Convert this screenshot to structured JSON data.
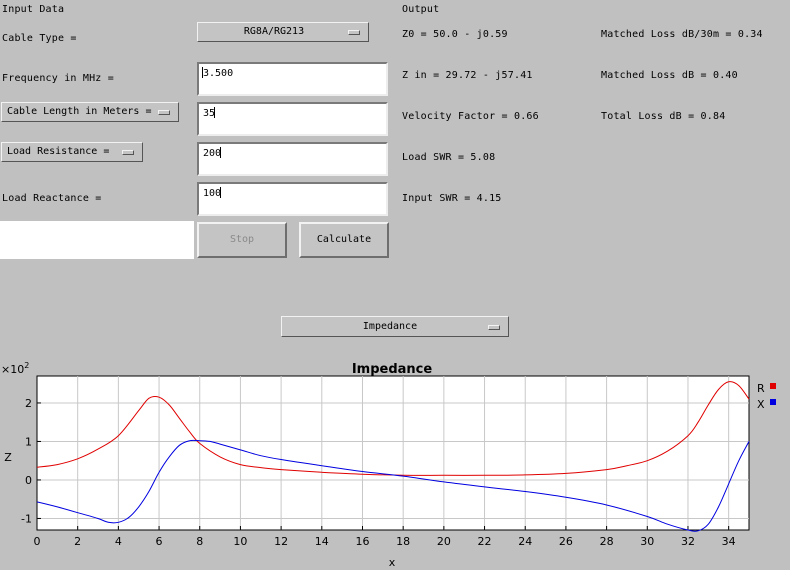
{
  "input": {
    "section_title": "Input Data",
    "cable_type_label": "Cable Type =",
    "cable_type_value": "RG8A/RG213",
    "frequency_label": "Frequency in MHz =",
    "frequency_value": "3.500",
    "length_menu_label": "Cable Length in Meters =",
    "length_value": "35",
    "load_menu_label": "Load Resistance =",
    "load_resistance_value": "200",
    "load_reactance_label": "Load Reactance =",
    "load_reactance_value": "100",
    "stop_label": "Stop",
    "calculate_label": "Calculate"
  },
  "output": {
    "section_title": "Output",
    "z0": "Z0 = 50.0 - j0.59",
    "matched_loss_per_30m": "Matched Loss dB/30m = 0.34",
    "z_in": "Z in = 29.72 - j57.41",
    "matched_loss": "Matched Loss dB = 0.40",
    "velocity_factor": "Velocity Factor = 0.66",
    "total_loss": "Total Loss dB = 0.84",
    "load_swr": "Load SWR = 5.08",
    "input_swr": "Input SWR = 4.15"
  },
  "plot_selector": {
    "value": "Impedance"
  },
  "colors": {
    "r_series": "#e00000",
    "x_series": "#0000e0",
    "background": "#c0c0c0"
  },
  "chart_data": {
    "type": "line",
    "title": "Impedance",
    "xlabel": "x",
    "ylabel": "Z",
    "scale_label_base": "×10",
    "scale_label_exp": "2",
    "xlim": [
      0,
      35
    ],
    "ylim": [
      -1.3,
      2.7
    ],
    "xticks": [
      0,
      2,
      4,
      6,
      8,
      10,
      12,
      14,
      16,
      18,
      20,
      22,
      24,
      26,
      28,
      30,
      32,
      34
    ],
    "yticks": [
      -1,
      0,
      1,
      2
    ],
    "grid": true,
    "legend": "top-right",
    "series": [
      {
        "name": "R",
        "color": "#e00000",
        "x": [
          0,
          1,
          2,
          3,
          4,
          5,
          5.5,
          6,
          6.5,
          7,
          7.5,
          8,
          9,
          10,
          11,
          12,
          14,
          16,
          18,
          20,
          22,
          24,
          26,
          28,
          29,
          30,
          31,
          32,
          32.5,
          33,
          33.5,
          34,
          34.5,
          35
        ],
        "y": [
          0.33,
          0.4,
          0.55,
          0.8,
          1.15,
          1.8,
          2.12,
          2.15,
          1.95,
          1.6,
          1.25,
          0.95,
          0.6,
          0.4,
          0.32,
          0.27,
          0.2,
          0.15,
          0.12,
          0.12,
          0.12,
          0.13,
          0.17,
          0.27,
          0.37,
          0.5,
          0.75,
          1.15,
          1.5,
          1.95,
          2.35,
          2.55,
          2.45,
          2.1
        ]
      },
      {
        "name": "X",
        "color": "#0000e0",
        "x": [
          0,
          1,
          2,
          3,
          3.5,
          4,
          4.5,
          5,
          5.5,
          6,
          6.5,
          7,
          7.5,
          8,
          8.5,
          9,
          10,
          11,
          12,
          14,
          16,
          18,
          20,
          22,
          24,
          26,
          28,
          30,
          31,
          32,
          32.5,
          33,
          33.5,
          34,
          34.5,
          35
        ],
        "y": [
          -0.57,
          -0.7,
          -0.85,
          -1.0,
          -1.1,
          -1.1,
          -0.98,
          -0.7,
          -0.3,
          0.2,
          0.6,
          0.9,
          1.02,
          1.02,
          1.0,
          0.93,
          0.78,
          0.63,
          0.53,
          0.37,
          0.22,
          0.1,
          -0.05,
          -0.18,
          -0.3,
          -0.45,
          -0.65,
          -0.95,
          -1.15,
          -1.3,
          -1.32,
          -1.15,
          -0.7,
          -0.1,
          0.5,
          1.0
        ]
      }
    ]
  }
}
